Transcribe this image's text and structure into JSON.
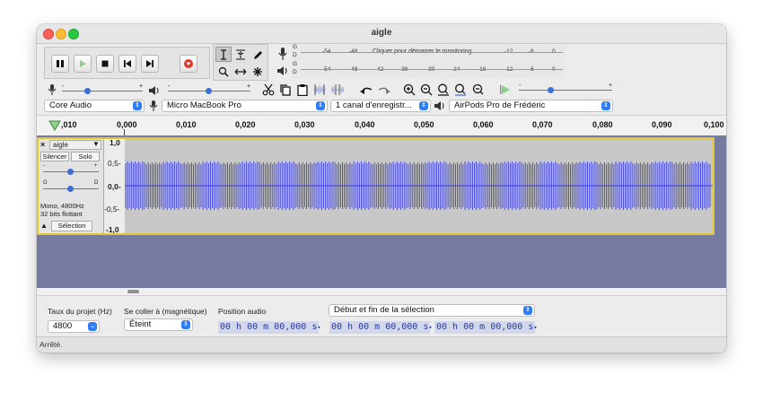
{
  "window": {
    "title": "aigle"
  },
  "transport": {
    "pause": "pause",
    "play": "play",
    "stop": "stop",
    "skip_start": "skip-start",
    "skip_end": "skip-end",
    "record": "record"
  },
  "meters": {
    "record_scale": [
      "G",
      "D",
      "-54",
      "-48",
      "-12",
      "-6",
      "0"
    ],
    "record_hint": "Cliquer pour démarrer le monitoring",
    "play_scale": [
      "G",
      "D",
      "-54",
      "-48",
      "-42",
      "-36",
      "-30",
      "-24",
      "-18",
      "-12",
      "-6",
      "0"
    ]
  },
  "device": {
    "host": "Core Audio",
    "input": "Micro MacBook Pro",
    "channels": "1 canal d'enregistr...",
    "output": "AirPods Pro de Frédéric"
  },
  "ruler": {
    "labels": [
      ",010",
      "0,000",
      "0,010",
      "0,020",
      "0,030",
      "0,040",
      "0,050",
      "0,060",
      "0,070",
      "0,080",
      "0,090",
      "0,100"
    ]
  },
  "track": {
    "name": "aigle",
    "mute_label": "Silencer",
    "solo_label": "Solo",
    "gain_minus": "-",
    "gain_plus": "+",
    "pan_left": "G",
    "pan_right": "D",
    "info_line1": "Mono, 4800Hz",
    "info_line2": "32 bits flottant",
    "select_label": "Sélection",
    "scale": [
      "1,0",
      "0,5-",
      "0,0-",
      "-0,5-",
      "-1,0"
    ]
  },
  "selection_bar": {
    "rate_label": "Taux du projet (Hz)",
    "rate_value": "4800",
    "snap_label": "Se coller à (magnétique)",
    "snap_value": "Éteint",
    "position_label": "Position audio",
    "position_value": "00 h 00 m 00,000 s",
    "selection_mode": "Début et fin de la sélection",
    "start_value": "00 h 00 m 00,000 s",
    "end_value": "00 h 00 m 00,000 s"
  },
  "status": {
    "text": "Arrêté."
  },
  "colors": {
    "waveform": "#3b3ee0",
    "track_bg": "#c8c8c8",
    "empty_area": "#757ca0",
    "select_accent": "#2f7ef7",
    "track_border": "#e0c930"
  }
}
